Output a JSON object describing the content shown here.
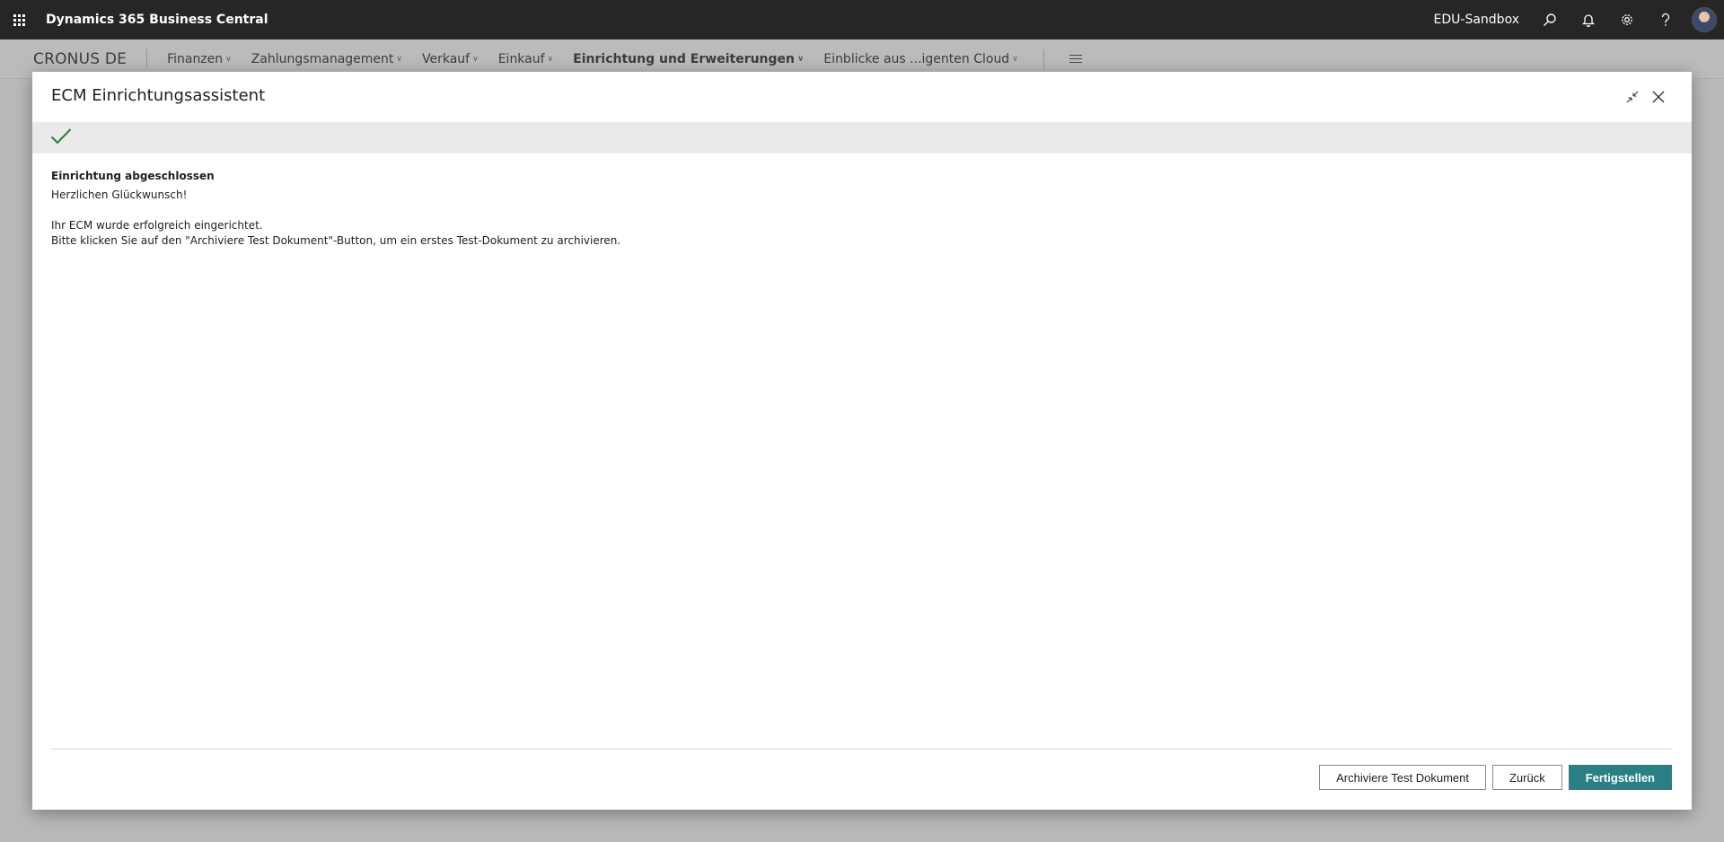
{
  "app": {
    "title": "Dynamics 365 Business Central",
    "environment": "EDU-Sandbox",
    "icons": {
      "waffle": "app-launcher-icon",
      "search": "search-icon",
      "notifications": "bell-icon",
      "settings": "gear-icon",
      "help": "help-icon",
      "avatar": "avatar"
    }
  },
  "nav": {
    "company": "CRONUS DE",
    "items": [
      {
        "label": "Finanzen",
        "bold": false
      },
      {
        "label": "Zahlungsmanagement",
        "bold": false
      },
      {
        "label": "Verkauf",
        "bold": false
      },
      {
        "label": "Einkauf",
        "bold": false
      },
      {
        "label": "Einrichtung und Erweiterungen",
        "bold": true
      },
      {
        "label": "Einblicke aus ...igenten Cloud",
        "bold": false
      }
    ]
  },
  "dialog": {
    "title": "ECM Einrichtungsassistent",
    "step_status": "completed",
    "heading": "Einrichtung abgeschlossen",
    "line1": "Herzlichen Glückwunsch!",
    "line2": "Ihr ECM wurde erfolgreich eingerichtet.",
    "line3": "Bitte klicken Sie auf den \"Archiviere Test Dokument\"-Button, um ein erstes Test-Dokument zu archivieren.",
    "buttons": {
      "archive": "Archiviere Test Dokument",
      "back": "Zurück",
      "finish": "Fertigstellen"
    }
  },
  "colors": {
    "topbar": "#262626",
    "primary": "#2a7f85",
    "check": "#2e7d32"
  }
}
